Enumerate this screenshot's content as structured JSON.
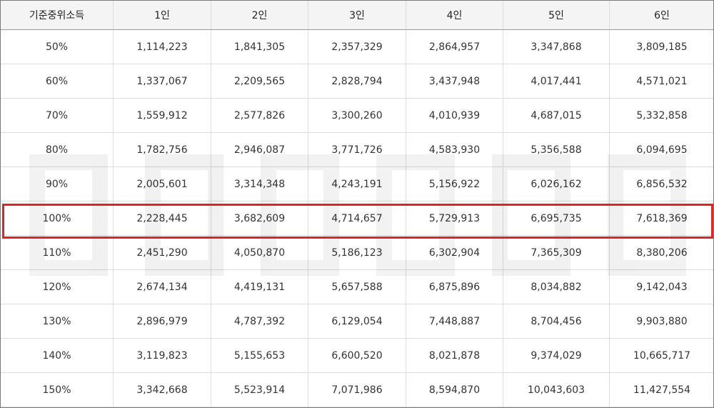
{
  "table": {
    "columns": [
      "기준중위소득",
      "1인",
      "2인",
      "3인",
      "4인",
      "5인",
      "6인"
    ],
    "rows": [
      [
        "50%",
        "1,114,223",
        "1,841,305",
        "2,357,329",
        "2,864,957",
        "3,347,868",
        "3,809,185"
      ],
      [
        "60%",
        "1,337,067",
        "2,209,565",
        "2,828,794",
        "3,437,948",
        "4,017,441",
        "4,571,021"
      ],
      [
        "70%",
        "1,559,912",
        "2,577,826",
        "3,300,260",
        "4,010,939",
        "4,687,015",
        "5,332,858"
      ],
      [
        "80%",
        "1,782,756",
        "2,946,087",
        "3,771,726",
        "4,583,930",
        "5,356,588",
        "6,094,695"
      ],
      [
        "90%",
        "2,005,601",
        "3,314,348",
        "4,243,191",
        "5,156,922",
        "6,026,162",
        "6,856,532"
      ],
      [
        "100%",
        "2,228,445",
        "3,682,609",
        "4,714,657",
        "5,729,913",
        "6,695,735",
        "7,618,369"
      ],
      [
        "110%",
        "2,451,290",
        "4,050,870",
        "5,186,123",
        "6,302,904",
        "7,365,309",
        "8,380,206"
      ],
      [
        "120%",
        "2,674,134",
        "4,419,131",
        "5,657,588",
        "6,875,896",
        "8,034,882",
        "9,142,043"
      ],
      [
        "130%",
        "2,896,979",
        "4,787,392",
        "6,129,054",
        "7,448,887",
        "8,704,456",
        "9,903,880"
      ],
      [
        "140%",
        "3,119,823",
        "5,155,653",
        "6,600,520",
        "8,021,878",
        "9,374,029",
        "10,665,717"
      ],
      [
        "150%",
        "3,342,668",
        "5,523,914",
        "7,071,986",
        "8,594,870",
        "10,043,603",
        "11,427,554"
      ]
    ],
    "highlighted_row": "100%"
  },
  "colors": {
    "highlight_border": "#e02424",
    "header_background": "#f4f4f4",
    "grid_line": "#dddddd"
  }
}
